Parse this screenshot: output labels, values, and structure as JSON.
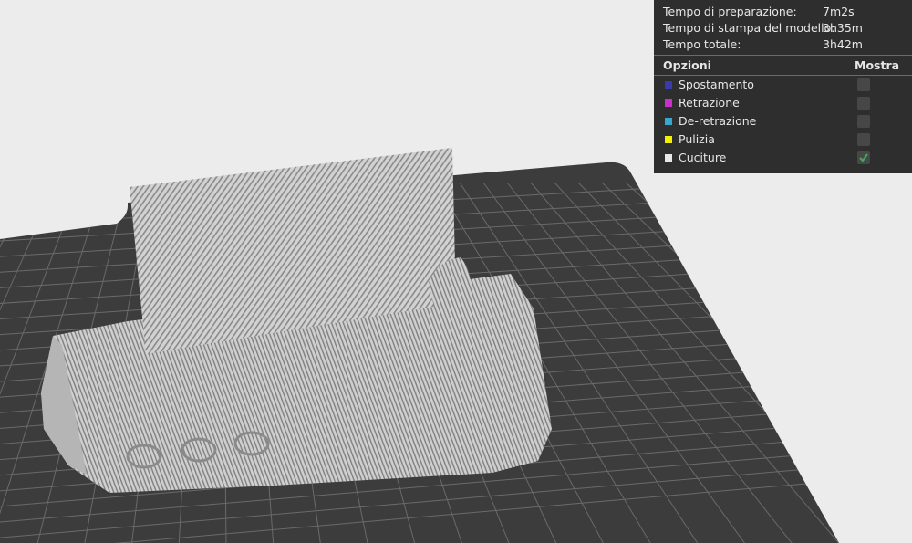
{
  "stats": [
    {
      "label": "Tempo di preparazione:",
      "value": "7m2s"
    },
    {
      "label": "Tempo di stampa del modello:",
      "value": "3h35m"
    },
    {
      "label": "Tempo totale:",
      "value": "3h42m"
    }
  ],
  "options_header": {
    "title": "Opzioni",
    "show": "Mostra"
  },
  "options": [
    {
      "label": "Spostamento",
      "color": "#3a3ab0",
      "checked": false
    },
    {
      "label": "Retrazione",
      "color": "#c830c8",
      "checked": false
    },
    {
      "label": "De-retrazione",
      "color": "#35a8d0",
      "checked": false
    },
    {
      "label": "Pulizia",
      "color": "#f0f000",
      "checked": false
    },
    {
      "label": "Cuciture",
      "color": "#e8e8e8",
      "checked": true
    }
  ],
  "colors": {
    "bed": "#3c3c3c",
    "grid": "#6a6a6a",
    "model": "#c8c8c8",
    "background": "#ececec",
    "panel": "#2e2e2e",
    "check": "#3fae5a"
  },
  "icons": [
    "checkmark-icon"
  ]
}
